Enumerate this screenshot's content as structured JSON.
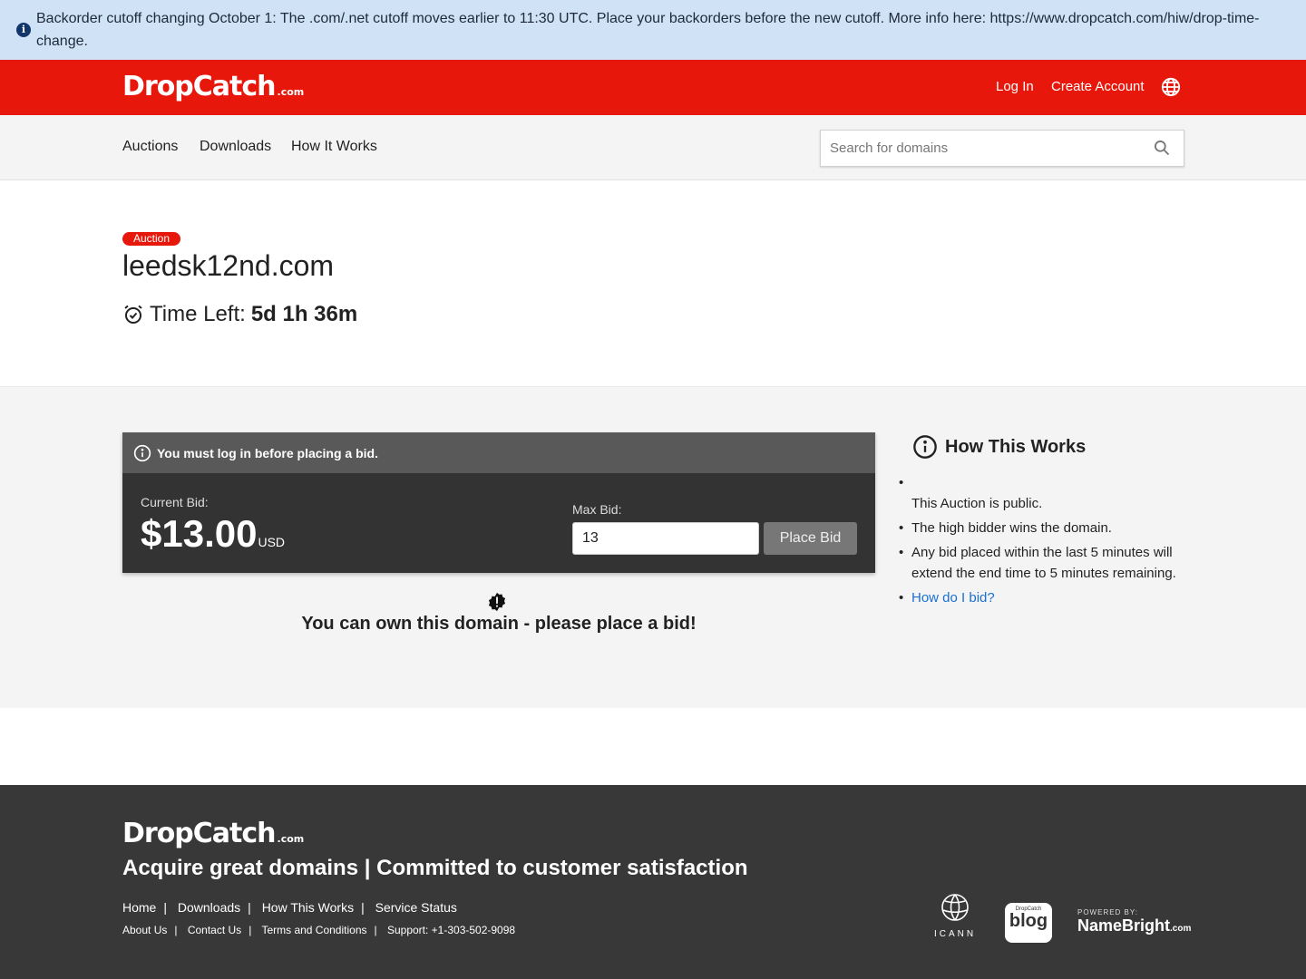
{
  "banner": {
    "text": "Backorder cutoff changing October 1: The .com/.net cutoff moves earlier to 11:30 UTC. Place your backorders before the new cutoff. More info here: https://www.dropcatch.com/hiw/drop-time-change.",
    "icon": "info-icon"
  },
  "brand": {
    "name": "DropCatch",
    "suffix": ".com",
    "color": "#e8170c"
  },
  "topbar": {
    "login": "Log In",
    "create_account": "Create Account",
    "language_icon": "globe-icon"
  },
  "nav": {
    "items": [
      "Auctions",
      "Downloads",
      "How It Works"
    ],
    "search_placeholder": "Search for domains"
  },
  "auction": {
    "badge": "Auction",
    "domain": "leedsk12nd.com",
    "time_left_label": "Time Left:",
    "time_left_value": "5d 1h 36m"
  },
  "bid": {
    "login_notice": "You must log in before placing a bid.",
    "current_label": "Current Bid:",
    "current_value": "$13.00",
    "currency": "USD",
    "max_label": "Max Bid:",
    "max_value": "13",
    "place_button": "Place Bid",
    "own_message": "You can own this domain - please place a bid!"
  },
  "how": {
    "title": "How This Works",
    "items": [
      "This Auction is public.",
      "The high bidder wins the domain.",
      "Any bid placed within the last 5 minutes will extend the end time to 5 minutes remaining."
    ],
    "link": "How do I bid?"
  },
  "footer": {
    "logo_name": "DropCatch",
    "logo_suffix": ".com",
    "tagline": "Acquire great domains | Committed to customer satisfaction",
    "links_primary": [
      "Home",
      "Downloads",
      "How This Works",
      "Service Status"
    ],
    "links_secondary": [
      "About Us",
      "Contact Us",
      "Terms and Conditions",
      "Support: +1-303-502-9098"
    ],
    "icann": "ICANN",
    "blog_small": "DropCatch",
    "blog_big": "blog",
    "powered_by": "POWERED BY:",
    "namebright": "NameBright",
    "namebright_suffix": ".com"
  }
}
